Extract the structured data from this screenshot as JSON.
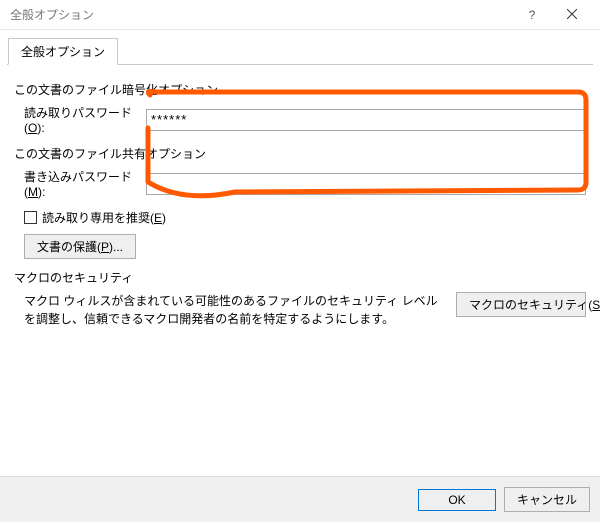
{
  "window": {
    "title": "全般オプション"
  },
  "tab": {
    "label": "全般オプション"
  },
  "encryption": {
    "group_label": "この文書のファイル暗号化オプション",
    "read_password_label_pre": "読み取りパスワード(",
    "read_password_label_key": "O",
    "read_password_label_post": "):",
    "read_password_value": "******"
  },
  "sharing": {
    "group_label": "この文書のファイル共有オプション",
    "write_password_label_pre": "書き込みパスワード(",
    "write_password_label_key": "M",
    "write_password_label_post": "):",
    "write_password_value": ""
  },
  "readonly": {
    "label_pre": "読み取り専用を推奨(",
    "label_key": "E",
    "label_post": ")"
  },
  "protect_doc": {
    "label_pre": "文書の保護(",
    "label_key": "P",
    "label_post": ")..."
  },
  "macro": {
    "group_label": "マクロのセキュリティ",
    "text": "マクロ ウィルスが含まれている可能性のあるファイルのセキュリティ レベルを調整し、信頼できるマクロ開発者の名前を特定するようにします。",
    "button_pre": "マクロのセキュリティ(",
    "button_key": "S",
    "button_post": ")..."
  },
  "footer": {
    "ok": "OK",
    "cancel": "キャンセル"
  }
}
